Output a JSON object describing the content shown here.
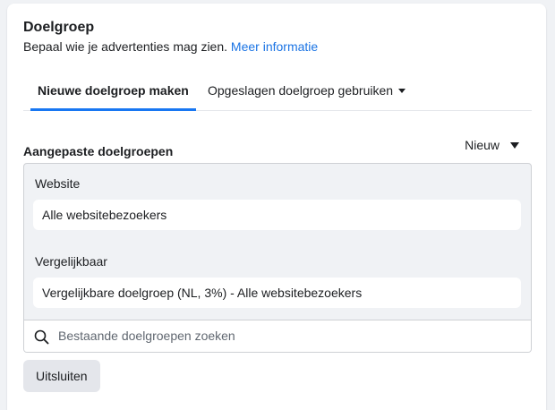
{
  "header": {
    "title": "Doelgroep",
    "subtitle": "Bepaal wie je advertenties mag zien.",
    "link": "Meer informatie"
  },
  "tabs": [
    {
      "label": "Nieuwe doelgroep maken",
      "active": true
    },
    {
      "label": "Opgeslagen doelgroep gebruiken",
      "active": false
    }
  ],
  "custom_audiences": {
    "label": "Aangepaste doelgroepen",
    "new_label": "Nieuw",
    "groups": [
      {
        "label": "Website",
        "value": "Alle websitebezoekers"
      },
      {
        "label": "Vergelijkbaar",
        "value": "Vergelijkbare doelgroep (NL, 3%) - Alle websitebezoekers"
      }
    ],
    "search_placeholder": "Bestaande doelgroepen zoeken"
  },
  "exclude_label": "Uitsluiten",
  "colors": {
    "accent": "#1877f2",
    "link": "#1b74e4"
  },
  "icons": [
    "search-icon",
    "caret-down-icon"
  ]
}
